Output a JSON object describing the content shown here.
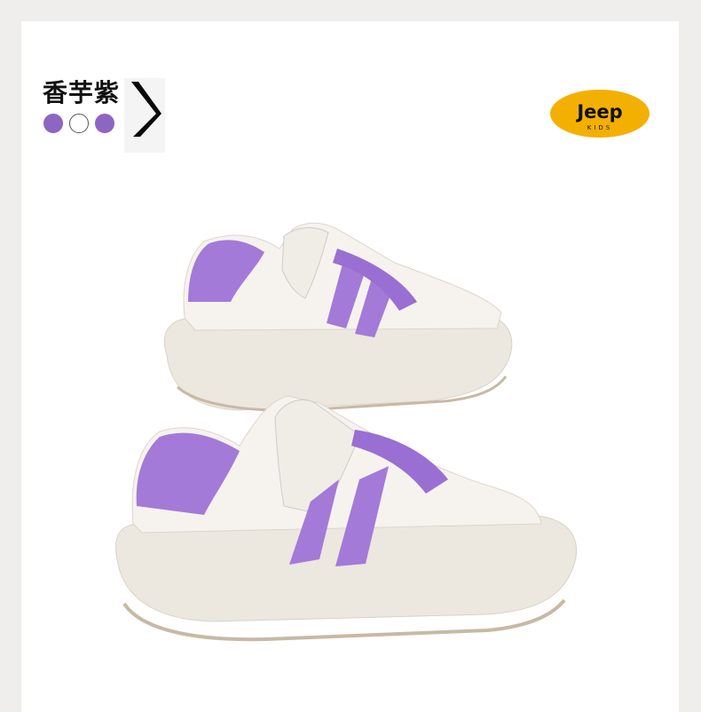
{
  "product": {
    "color_name": "香芋紫",
    "color_swatches": [
      {
        "name": "purple",
        "color": "#8d66c4"
      },
      {
        "name": "white",
        "color": "#ffffff"
      },
      {
        "name": "purple",
        "color": "#8d66c4"
      }
    ],
    "arrow_icon": "chevron-right-icon"
  },
  "brand": {
    "logo_text": "Jeep",
    "logo_sub": "KIDS",
    "logo_color": "#f4b000"
  },
  "colors": {
    "accent_purple": "#a37ad8",
    "shoe_white": "#f5f2ec",
    "page_bg": "#efeeec"
  }
}
